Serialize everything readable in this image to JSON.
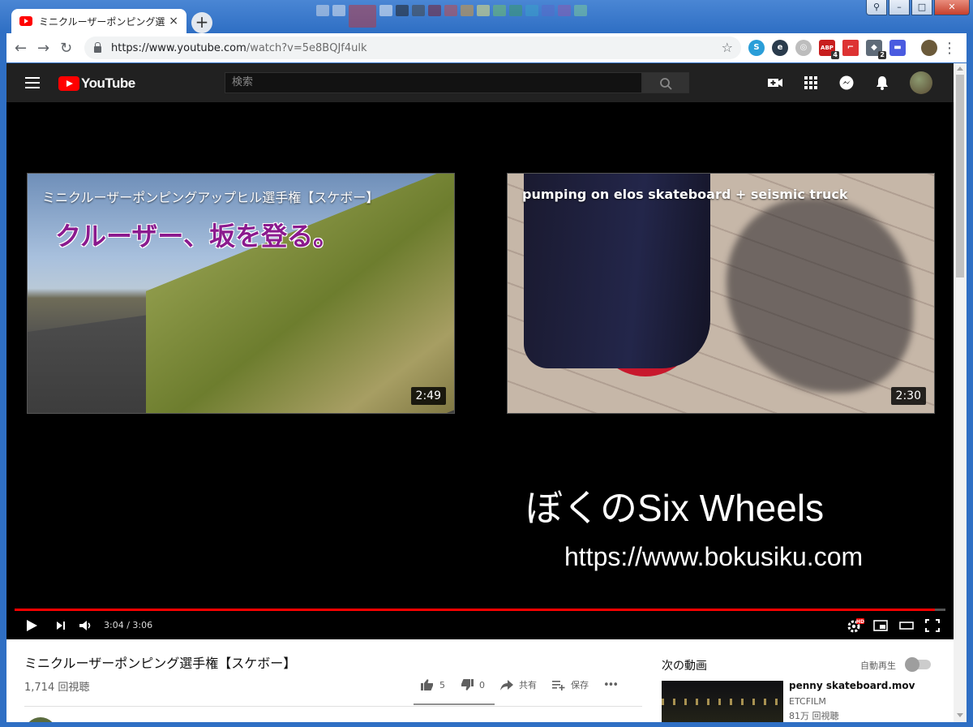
{
  "browser": {
    "tab_title": "ミニクルーザーポンピング選手権",
    "tab_close": "×",
    "new_tab": "+",
    "url_host": "https://www.youtube.com",
    "url_path": "/watch?v=5e8BQJf4ulk",
    "extension_badges": {
      "abp": "4",
      "ext2": "2"
    },
    "window_controls": {
      "minimize": "–",
      "maximize": "□",
      "close": "✕"
    }
  },
  "youtube": {
    "logo_text": "YouTube",
    "search_placeholder": "検索"
  },
  "player": {
    "endcards": [
      {
        "title": "ミニクルーザーポンピングアップヒル選手権【スケボー】",
        "overlay": "クルーザー、坂を登る。",
        "duration": "2:49"
      },
      {
        "title": "pumping on elos skateboard + seismic truck",
        "duration": "2:30"
      }
    ],
    "brand_line1": "ぼくのSix Wheels",
    "brand_line2": "https://www.bokusiku.com",
    "time_text": "3:04 / 3:06",
    "progress_fraction": 0.989,
    "hd_badge": "HD"
  },
  "video": {
    "title": "ミニクルーザーポンピング選手権【スケボー】",
    "views": "1,714 回視聴",
    "likes": "5",
    "dislikes": "0",
    "share_label": "共有",
    "save_label": "保存",
    "more_label": "•••"
  },
  "sidebar": {
    "next_label": "次の動画",
    "autoplay_label": "自動再生",
    "next_video": {
      "title": "penny skateboard.mov",
      "channel": "ETCFILM",
      "views": "81万 回視聴"
    }
  },
  "colors": {
    "youtube_red": "#ff0000",
    "header_bg": "#212121",
    "browser_frame": "#2f6fc4"
  }
}
